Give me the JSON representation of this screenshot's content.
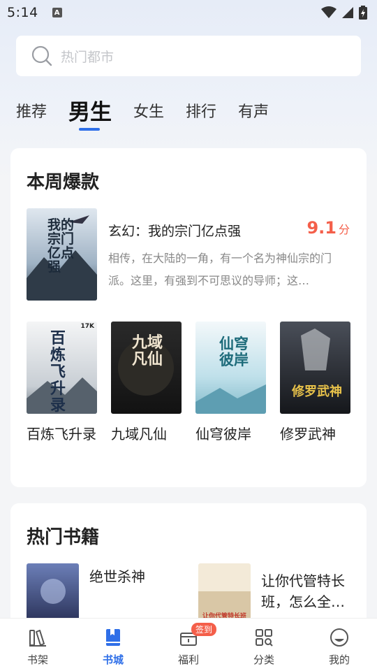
{
  "status_bar": {
    "time": "5:14",
    "notification_letter": "A"
  },
  "search": {
    "placeholder": "热门都市"
  },
  "tabs": [
    {
      "label": "推荐",
      "active": false
    },
    {
      "label": "男生",
      "active": true
    },
    {
      "label": "女生",
      "active": false
    },
    {
      "label": "排行",
      "active": false
    },
    {
      "label": "有声",
      "active": false
    }
  ],
  "weekly": {
    "title": "本周爆款",
    "featured": {
      "title": "玄幻：我的宗门亿点强",
      "score": "9.1",
      "score_unit": "分",
      "description": "相传，在大陆的一角，有一个名为神仙宗的门派。这里，有强到不可思议的导师；这…",
      "cover_text": "我的宗门亿点强"
    },
    "books": [
      {
        "name": "百炼飞升录",
        "cover_text": "百炼飞升录",
        "cover_badge": "17K"
      },
      {
        "name": "九域凡仙",
        "cover_text": "九域凡仙"
      },
      {
        "name": "仙穹彼岸",
        "cover_text": "仙穹彼岸"
      },
      {
        "name": "修罗武神",
        "cover_text": "修罗武神"
      }
    ]
  },
  "hot": {
    "title": "热门书籍",
    "books": [
      {
        "name": "绝世杀神"
      },
      {
        "name": "让你代管特长班，怎么全…",
        "name_line1": "让你代管特长",
        "name_line2": "班，怎么全…",
        "cover_text": "让你代管特长班"
      }
    ]
  },
  "bottom_nav": [
    {
      "label": "书架",
      "icon": "bookshelf-icon",
      "active": false
    },
    {
      "label": "书城",
      "icon": "bookstore-icon",
      "active": true
    },
    {
      "label": "福利",
      "icon": "gift-icon",
      "active": false,
      "badge": "签到"
    },
    {
      "label": "分类",
      "icon": "category-icon",
      "active": false
    },
    {
      "label": "我的",
      "icon": "profile-icon",
      "active": false
    }
  ],
  "colors": {
    "accent": "#2f6fe8",
    "score": "#f45f4a",
    "badge": "#f45f4a"
  }
}
